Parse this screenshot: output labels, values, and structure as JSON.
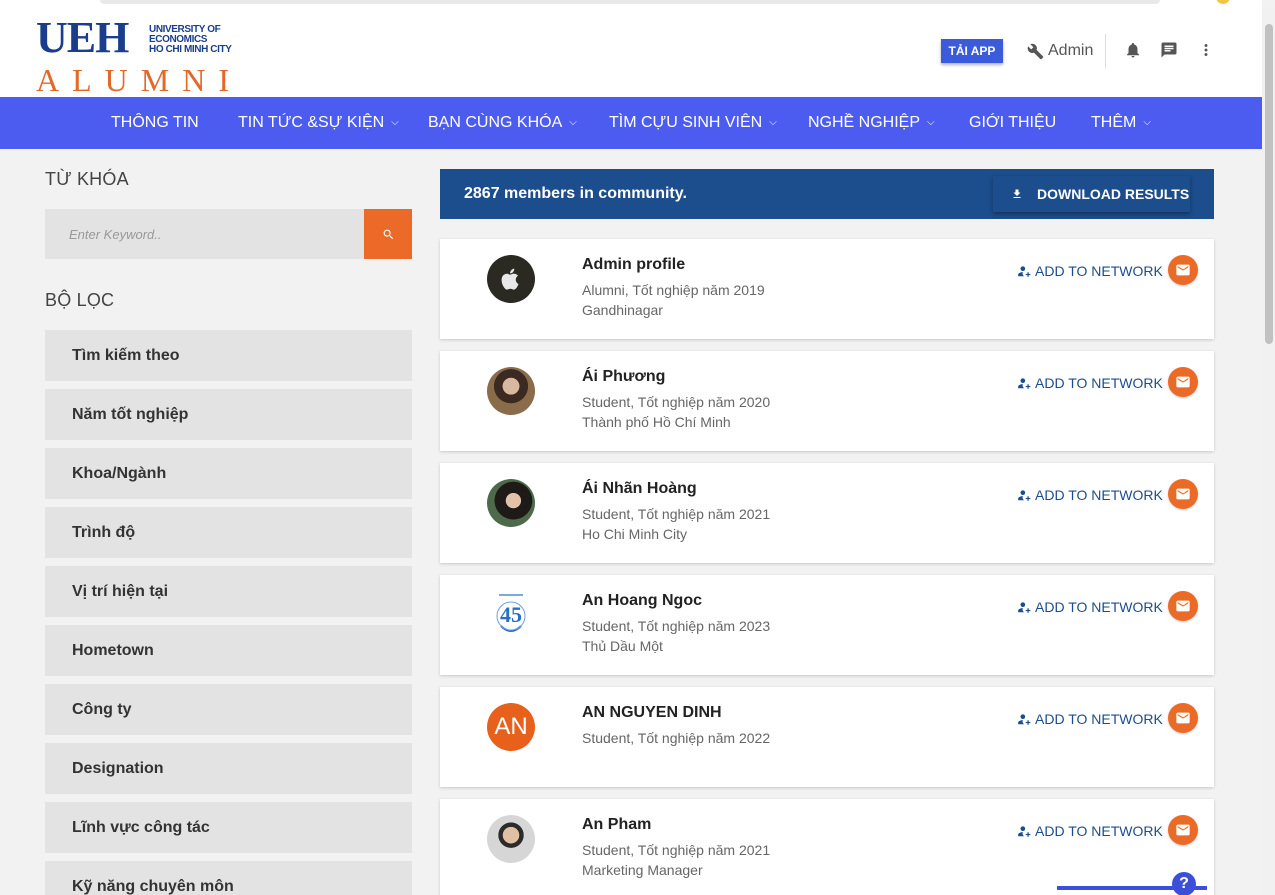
{
  "logo": {
    "main": "UEH",
    "university_lines": [
      "UNIVERSITY OF",
      "ECONOMICS",
      "HO CHI MINH CITY"
    ],
    "sub": "ALUMNI"
  },
  "header": {
    "app_button": "TẢI APP",
    "user_label": "Admin",
    "icons": [
      "wrench-icon",
      "bell-icon",
      "chat-icon",
      "more-vert-icon"
    ]
  },
  "nav": [
    {
      "label": "THÔNG TIN",
      "dropdown": false
    },
    {
      "label": "TIN TỨC &SỰ KIỆN",
      "dropdown": true
    },
    {
      "label": "BẠN CÙNG KHÓA",
      "dropdown": true
    },
    {
      "label": "TÌM CỰU SINH VIÊN",
      "dropdown": true
    },
    {
      "label": "NGHỀ NGHIỆP",
      "dropdown": true
    },
    {
      "label": "GIỚI THIỆU",
      "dropdown": false
    },
    {
      "label": "THÊM",
      "dropdown": true
    }
  ],
  "sidebar": {
    "keyword_label": "TỪ KHÓA",
    "keyword_placeholder": "Enter Keyword..",
    "filter_label": "BỘ LỌC",
    "filters": [
      "Tìm kiếm theo",
      "Năm tốt nghiệp",
      "Khoa/Ngành",
      "Trình độ",
      "Vị trí hiện tại",
      "Hometown",
      "Công ty",
      "Designation",
      "Lĩnh vực công tác",
      "Kỹ năng chuyên môn"
    ]
  },
  "results": {
    "count_text": "2867 members in community.",
    "download_label": "DOWNLOAD RESULTS",
    "add_label": "ADD TO NETWORK",
    "members": [
      {
        "name": "Admin profile",
        "meta": "Alumni, Tốt nghiệp năm 2019",
        "location": "Gandhinagar",
        "avatar": "apple-logo"
      },
      {
        "name": "Ái Phương",
        "meta": "Student, Tốt nghiệp năm 2020",
        "location": "Thành phố Hồ Chí Minh",
        "avatar": "photo"
      },
      {
        "name": "Ái Nhãn Hoàng",
        "meta": "Student, Tốt nghiệp năm 2021",
        "location": "Ho Chi Minh City",
        "avatar": "photo"
      },
      {
        "name": "An Hoang Ngoc",
        "meta": "Student, Tốt nghiệp năm 2023",
        "location": "Thủ Dầu Một",
        "avatar": "emblem"
      },
      {
        "name": "AN NGUYEN DINH",
        "meta": "Student, Tốt nghiệp năm 2022",
        "location": "",
        "avatar": "initials",
        "initials": "AN"
      },
      {
        "name": "An Pham",
        "meta": "Student, Tốt nghiệp năm 2021",
        "location": "Marketing Manager",
        "avatar": "photo"
      }
    ]
  },
  "help": {
    "label": "?"
  },
  "colors": {
    "nav": "#4d5cf0",
    "banner": "#1c4d8c",
    "accent": "#eb6a27",
    "logo_blue": "#1b3e8c"
  }
}
